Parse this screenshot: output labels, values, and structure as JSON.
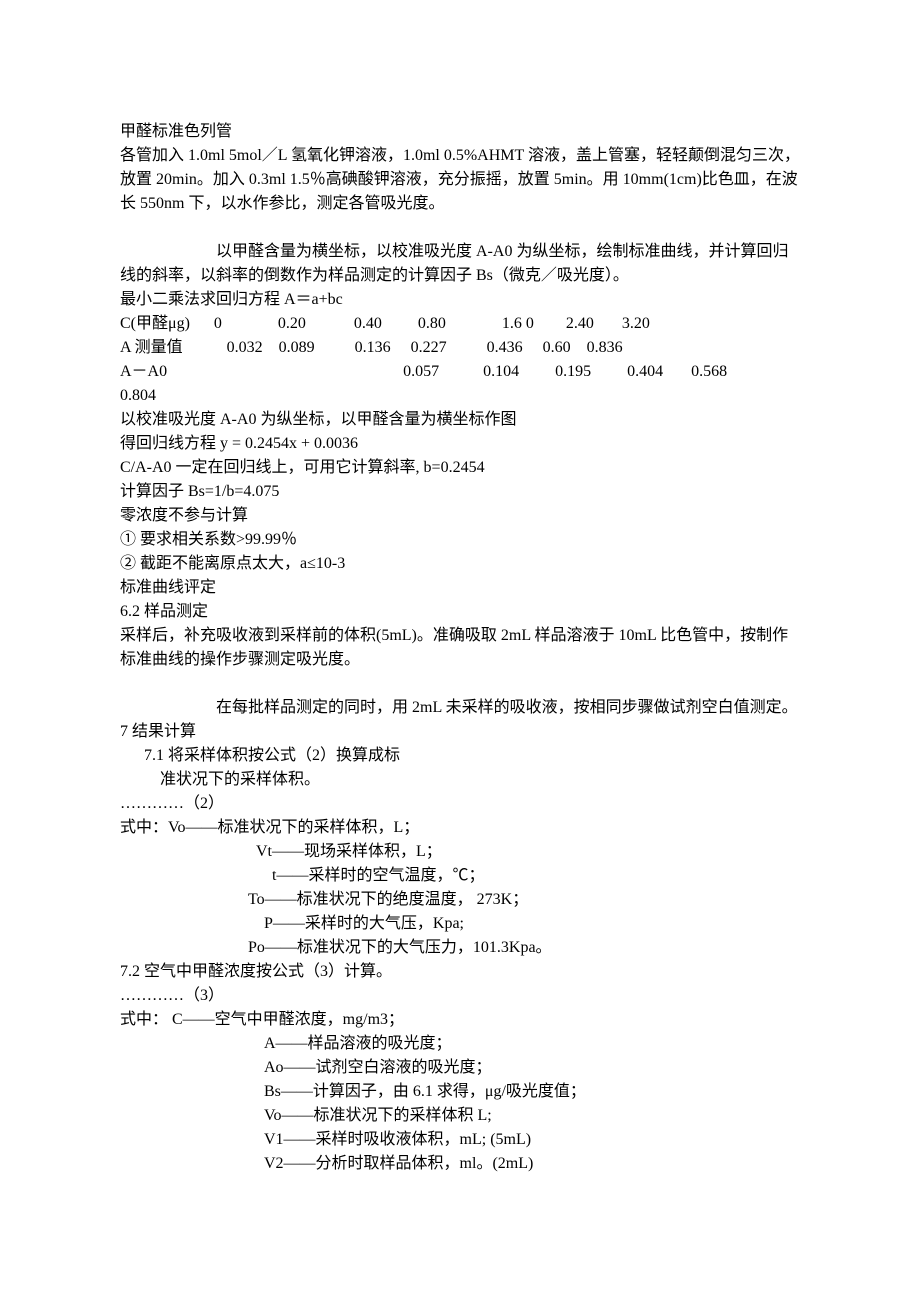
{
  "title": "甲醛标准色列管",
  "p1": "各管加入 1.0ml 5mol／L 氢氧化钾溶液，1.0ml 0.5%AHMT 溶液，盖上管塞，轻轻颠倒混匀三次，放置 20min。加入 0.3ml 1.5％高碘酸钾溶液，充分振摇，放置 5min。用 10mm(1cm)比色皿，在波长 550nm 下，以水作参比，测定各管吸光度。",
  "p2": "以甲醛含量为横坐标，以校准吸光度 A-A0 为纵坐标，绘制标准曲线，并计算回归线的斜率，以斜率的倒数作为样品测定的计算因子 Bs（微克／吸光度）。",
  "p3": "最小二乘法求回归方程   A＝a+bc",
  "row1": "C(甲醛μg)      0              0.20            0.40         0.80              1.6 0        2.40       3.20",
  "row2": "A 测量值           0.032    0.089          0.136     0.227          0.436     0.60    0.836",
  "row3": "A－A0                                                           0.057           0.104         0.195         0.404       0.568",
  "row3b": "0.804",
  "p4": "以校准吸光度 A-A0 为纵坐标，以甲醛含量为横坐标作图",
  "p5": "得回归线方程  y = 0.2454x + 0.0036",
  "p6": "C/A-A0 一定在回归线上，可用它计算斜率, b=0.2454",
  "p7": "计算因子 Bs=1/b=4.075",
  "p8": "零浓度不参与计算",
  "p9": "①    要求相关系数>99.99％",
  "p10": "  ②  截距不能离原点太大，a≤10-3",
  "p11": "标准曲线评定",
  "p12": "6.2  样品测定",
  "p13": "采样后，补充吸收液到采样前的体积(5mL)。准确吸取 2mL 样品溶液于 10mL 比色管中，按制作标准曲线的操作步骤测定吸光度。",
  "p14": "在每批样品测定的同时，用 2mL 未采样的吸收液，按相同步骤做试剂空白值测定。",
  "p15": "7  结果计算",
  "p16": "7.1  将采样体积按公式（2）换算成标",
  "p17": "准状况下的采样体积。",
  "p18": "…………（2）",
  "p19": "式中：Vo――标准状况下的采样体积，L；",
  "p20": "Vt――现场采样体积，L；",
  "p21": "t――采样时的空气温度，℃；",
  "p22": "To――标准状况下的绝度温度，  273K；",
  "p23": "P――采样时的大气压，Kpa;",
  "p24": "Po――标准状况下的大气压力，101.3Kpa。",
  "p25": "7.2  空气中甲醛浓度按公式（3）计算。",
  "p26": "…………（3）",
  "p27": "式中：       C――空气中甲醛浓度，mg/m3；",
  "p28": "A――样品溶液的吸光度；",
  "p29": "Ao――试剂空白溶液的吸光度；",
  "p30": "Bs――计算因子，由 6.1 求得，μg/吸光度值；",
  "p31": "Vo――标准状况下的采样体积 L;",
  "p32": "V1――采样时吸收液体积，mL; (5mL)",
  "p33": "V2――分析时取样品体积，ml。(2mL)"
}
